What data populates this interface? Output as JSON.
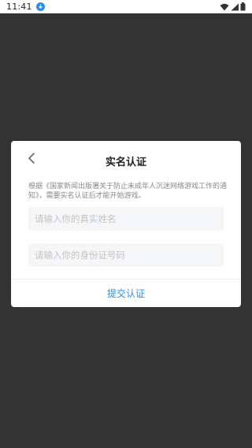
{
  "status_bar": {
    "time": "11:41",
    "notification_icon": "download-arrow-icon",
    "icons": [
      "wifi-icon",
      "cellular-signal-icon",
      "battery-icon"
    ]
  },
  "modal": {
    "title": "实名认证",
    "back_icon": "chevron-left-icon",
    "notice": "根据《国家新闻出版署关于防止未成年人沉迷网络游戏工作的通知》，需要实名认证后才能开始游戏。",
    "name_input": {
      "placeholder": "请输入你的真实姓名",
      "value": ""
    },
    "id_input": {
      "placeholder": "请输入你的身份证号码",
      "value": ""
    },
    "submit_label": "提交认证"
  },
  "colors": {
    "accent": "#2d8cf0",
    "overlay": "#333333",
    "input_bg": "#f5f6f8"
  }
}
